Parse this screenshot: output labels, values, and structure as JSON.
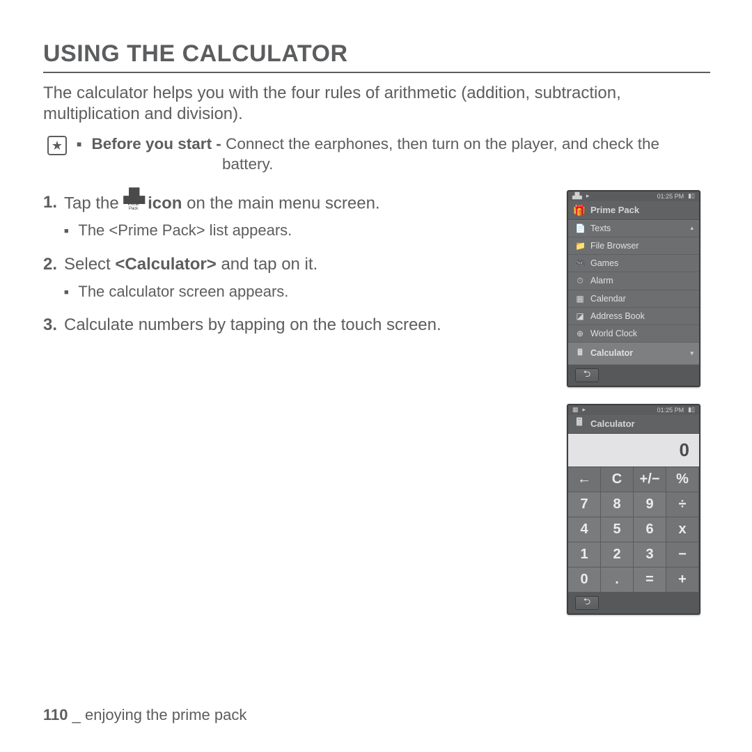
{
  "title": "USING THE CALCULATOR",
  "intro": "The calculator helps you with the four rules of arithmetic (addition, subtraction, multiplication and division).",
  "before": {
    "label": "Before you start -",
    "text1": " Connect the earphones, then turn on the player, and check the",
    "text2": "battery."
  },
  "icon_label": "Prime Pack",
  "steps": [
    {
      "num": "1.",
      "pre": "Tap the ",
      "post_bold": " icon",
      "post_plain": " on the main menu screen.",
      "sub": "The <Prime Pack> list appears."
    },
    {
      "num": "2.",
      "pre": "Select ",
      "bold": "<Calculator>",
      "plain": " and tap on it.",
      "sub": "The calculator screen appears."
    },
    {
      "num": "3.",
      "plain_full": "Calculate numbers by tapping on the touch screen."
    }
  ],
  "device_time": "01:25 PM",
  "prime_pack": {
    "title": "Prime Pack",
    "items": [
      {
        "icon": "📄",
        "label": "Texts"
      },
      {
        "icon": "📁",
        "label": "File Browser"
      },
      {
        "icon": "🎮",
        "label": "Games"
      },
      {
        "icon": "⏱",
        "label": "Alarm"
      },
      {
        "icon": "▦",
        "label": "Calendar"
      },
      {
        "icon": "◪",
        "label": "Address Book"
      },
      {
        "icon": "⊕",
        "label": "World Clock"
      },
      {
        "icon": "🖩",
        "label": "Calculator",
        "selected": true
      }
    ]
  },
  "calc": {
    "title": "Calculator",
    "display": "0",
    "keys": [
      [
        "←",
        "C",
        "+/−",
        "%"
      ],
      [
        "7",
        "8",
        "9",
        "÷"
      ],
      [
        "4",
        "5",
        "6",
        "x"
      ],
      [
        "1",
        "2",
        "3",
        "−"
      ],
      [
        "0",
        ".",
        "=",
        "+"
      ]
    ]
  },
  "footer": {
    "page": "110",
    "sep": " _ ",
    "text": "enjoying the prime pack"
  }
}
